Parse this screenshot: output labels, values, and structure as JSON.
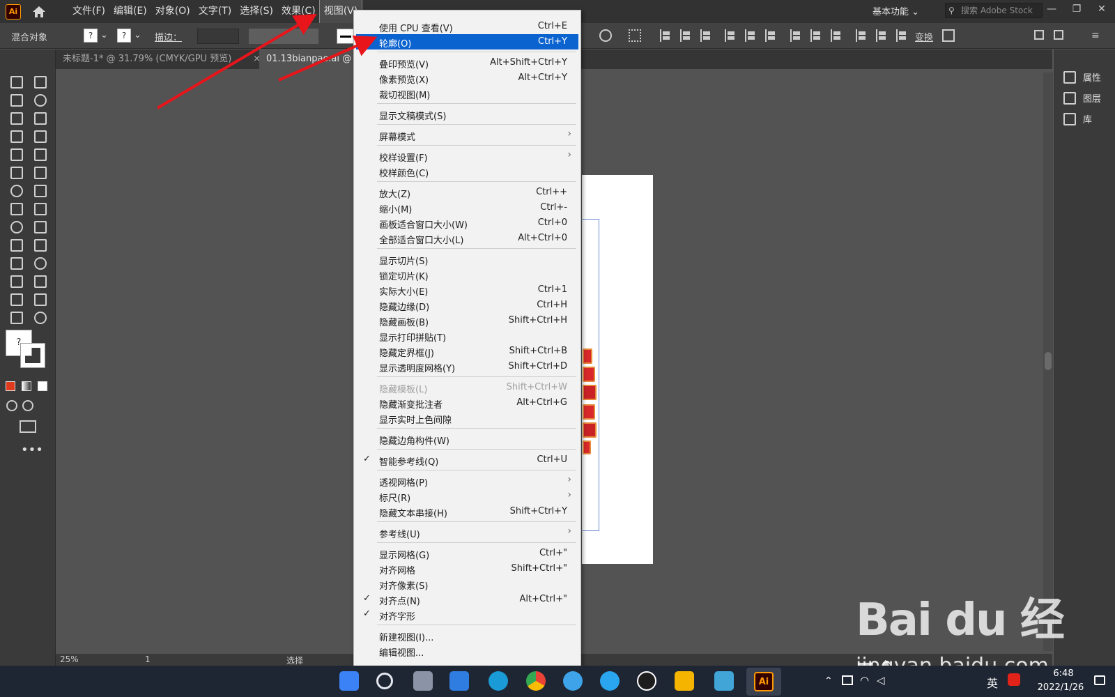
{
  "app": {
    "logo": "Ai"
  },
  "menubar": {
    "items": [
      "文件(F)",
      "编辑(E)",
      "对象(O)",
      "文字(T)",
      "选择(S)",
      "效果(C)",
      "视图(V)"
    ],
    "workspace": "基本功能",
    "search_placeholder": "搜索 Adobe Stock"
  },
  "controlbar": {
    "object_label": "混合对象",
    "fill_q": "?",
    "stroke_q": "?",
    "stroke_label": "描边：",
    "transform_label": "变换"
  },
  "tabs": [
    {
      "label": "未标题-1* @ 31.79% (CMYK/GPU 预览)",
      "close": "×"
    },
    {
      "label": "01.13bianpao.ai @",
      "close": ""
    }
  ],
  "right_panel": {
    "items": [
      "属性",
      "图层",
      "库"
    ]
  },
  "statusbar": {
    "zoom": "25%",
    "page": "1",
    "status": "选择"
  },
  "view_menu": {
    "items": [
      {
        "label": "使用 CPU 查看(V)",
        "shortcut": "Ctrl+E"
      },
      {
        "label": "轮廓(O)",
        "shortcut": "Ctrl+Y"
      },
      {
        "label": "叠印预览(V)",
        "shortcut": "Alt+Shift+Ctrl+Y"
      },
      {
        "label": "像素预览(X)",
        "shortcut": "Alt+Ctrl+Y"
      },
      {
        "label": "裁切视图(M)",
        "shortcut": ""
      },
      {
        "label": "显示文稿模式(S)",
        "shortcut": ""
      },
      {
        "label": "屏幕模式",
        "shortcut": ""
      },
      {
        "label": "校样设置(F)",
        "shortcut": ""
      },
      {
        "label": "校样颜色(C)",
        "shortcut": ""
      },
      {
        "label": "放大(Z)",
        "shortcut": "Ctrl++"
      },
      {
        "label": "缩小(M)",
        "shortcut": "Ctrl+-"
      },
      {
        "label": "画板适合窗口大小(W)",
        "shortcut": "Ctrl+0"
      },
      {
        "label": "全部适合窗口大小(L)",
        "shortcut": "Alt+Ctrl+0"
      },
      {
        "label": "显示切片(S)",
        "shortcut": ""
      },
      {
        "label": "锁定切片(K)",
        "shortcut": ""
      },
      {
        "label": "实际大小(E)",
        "shortcut": "Ctrl+1"
      },
      {
        "label": "隐藏边缘(D)",
        "shortcut": "Ctrl+H"
      },
      {
        "label": "隐藏画板(B)",
        "shortcut": "Shift+Ctrl+H"
      },
      {
        "label": "显示打印拼贴(T)",
        "shortcut": ""
      },
      {
        "label": "隐藏定界框(J)",
        "shortcut": "Shift+Ctrl+B"
      },
      {
        "label": "显示透明度网格(Y)",
        "shortcut": "Shift+Ctrl+D"
      },
      {
        "label": "隐藏模板(L)",
        "shortcut": "Shift+Ctrl+W"
      },
      {
        "label": "隐藏渐变批注者",
        "shortcut": "Alt+Ctrl+G"
      },
      {
        "label": "显示实时上色间隙",
        "shortcut": ""
      },
      {
        "label": "隐藏边角构件(W)",
        "shortcut": ""
      },
      {
        "label": "智能参考线(Q)",
        "shortcut": "Ctrl+U"
      },
      {
        "label": "透视网格(P)",
        "shortcut": ""
      },
      {
        "label": "标尺(R)",
        "shortcut": ""
      },
      {
        "label": "隐藏文本串接(H)",
        "shortcut": "Shift+Ctrl+Y"
      },
      {
        "label": "参考线(U)",
        "shortcut": ""
      },
      {
        "label": "显示网格(G)",
        "shortcut": "Ctrl+\""
      },
      {
        "label": "对齐网格",
        "shortcut": "Shift+Ctrl+\""
      },
      {
        "label": "对齐像素(S)",
        "shortcut": ""
      },
      {
        "label": "对齐点(N)",
        "shortcut": "Alt+Ctrl+\""
      },
      {
        "label": "对齐字形",
        "shortcut": ""
      },
      {
        "label": "新建视图(I)...",
        "shortcut": ""
      },
      {
        "label": "编辑视图...",
        "shortcut": ""
      }
    ],
    "check_glyph": "✓",
    "submenu_glyph": "›"
  },
  "watermark": {
    "logo": "Bai du 经验",
    "url": "jingyan.baidu.com"
  },
  "taskbar": {
    "ime": "英",
    "time": "6:48",
    "date": "2022/1/26",
    "ai_logo": "Ai"
  },
  "colors": {
    "highlight": "#0b63d0",
    "arrow": "#e8151b",
    "ui_dark": "#323232"
  }
}
